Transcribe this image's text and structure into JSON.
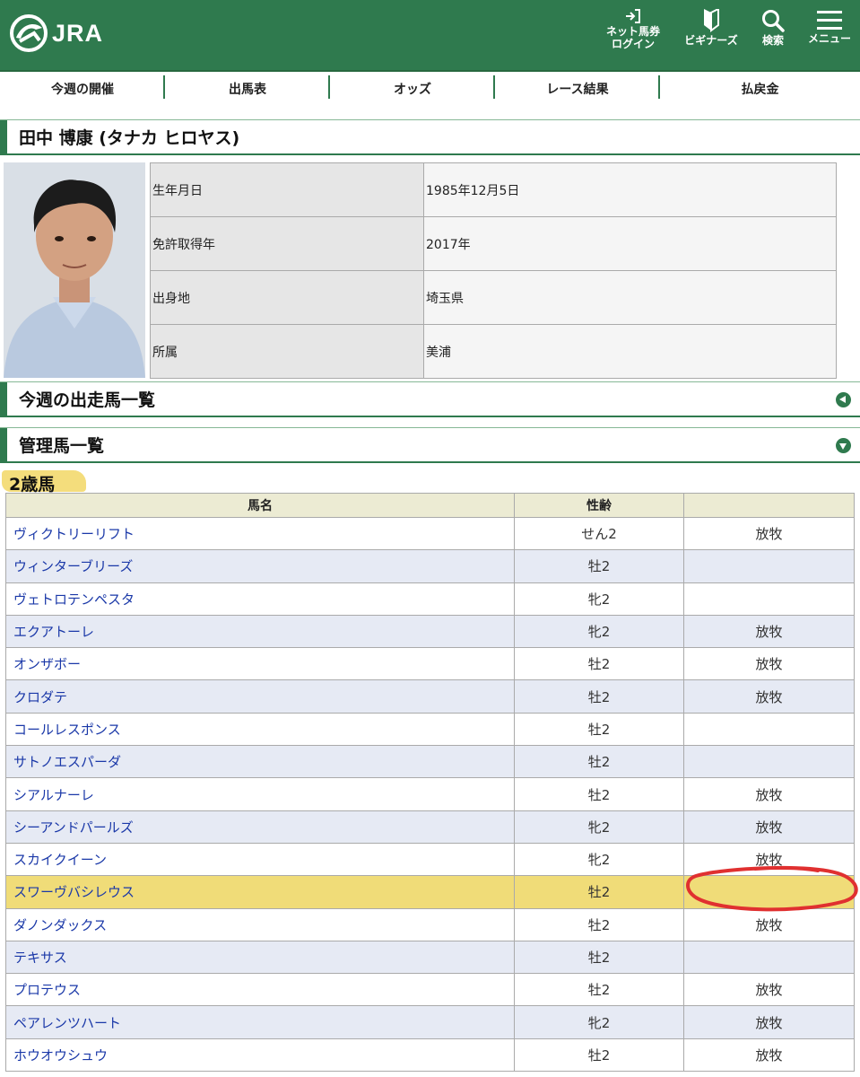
{
  "header": {
    "logo_text": "JRA",
    "nav": [
      {
        "label_line1": "ネット馬券",
        "label_line2": "ログイン",
        "icon": "login-icon"
      },
      {
        "label": "ビギナーズ",
        "icon": "beginner-icon"
      },
      {
        "label": "検索",
        "icon": "search-icon"
      },
      {
        "label": "メニュー",
        "icon": "menu-icon"
      }
    ],
    "brand_color": "#2f7a4e"
  },
  "tabs": [
    "今週の開催",
    "出馬表",
    "オッズ",
    "レース結果",
    "払戻金"
  ],
  "profile": {
    "title": "田中 博康 (タナカ ヒロヤス)",
    "rows": [
      {
        "label": "生年月日",
        "value": "1985年12月5日"
      },
      {
        "label": "免許取得年",
        "value": "2017年"
      },
      {
        "label": "出身地",
        "value": "埼玉県"
      },
      {
        "label": "所属",
        "value": "美浦"
      }
    ]
  },
  "sections": {
    "weekly": "今週の出走馬一覧",
    "managed": "管理馬一覧"
  },
  "horses": {
    "group_label": "2歳馬",
    "columns": [
      "馬名",
      "性齢",
      ""
    ],
    "rows": [
      {
        "name": "ヴィクトリーリフト",
        "sexage": "せん2",
        "status": "放牧"
      },
      {
        "name": "ウィンターブリーズ",
        "sexage": "牡2",
        "status": ""
      },
      {
        "name": "ヴェトロテンペスタ",
        "sexage": "牝2",
        "status": ""
      },
      {
        "name": "エクアトーレ",
        "sexage": "牝2",
        "status": "放牧"
      },
      {
        "name": "オンザボー",
        "sexage": "牡2",
        "status": "放牧"
      },
      {
        "name": "クロダテ",
        "sexage": "牡2",
        "status": "放牧"
      },
      {
        "name": "コールレスポンス",
        "sexage": "牡2",
        "status": ""
      },
      {
        "name": "サトノエスパーダ",
        "sexage": "牡2",
        "status": ""
      },
      {
        "name": "シアルナーレ",
        "sexage": "牡2",
        "status": "放牧"
      },
      {
        "name": "シーアンドパールズ",
        "sexage": "牝2",
        "status": "放牧"
      },
      {
        "name": "スカイクイーン",
        "sexage": "牝2",
        "status": "放牧"
      },
      {
        "name": "スワーヴバシレウス",
        "sexage": "牡2",
        "status": "",
        "highlighted": true
      },
      {
        "name": "ダノンダックス",
        "sexage": "牡2",
        "status": "放牧"
      },
      {
        "name": "テキサス",
        "sexage": "牡2",
        "status": ""
      },
      {
        "name": "プロテウス",
        "sexage": "牡2",
        "status": "放牧"
      },
      {
        "name": "ペアレンツハート",
        "sexage": "牝2",
        "status": "放牧"
      },
      {
        "name": "ホウオウシュウ",
        "sexage": "牡2",
        "status": "放牧"
      }
    ]
  },
  "annotation_color": "#e03030"
}
